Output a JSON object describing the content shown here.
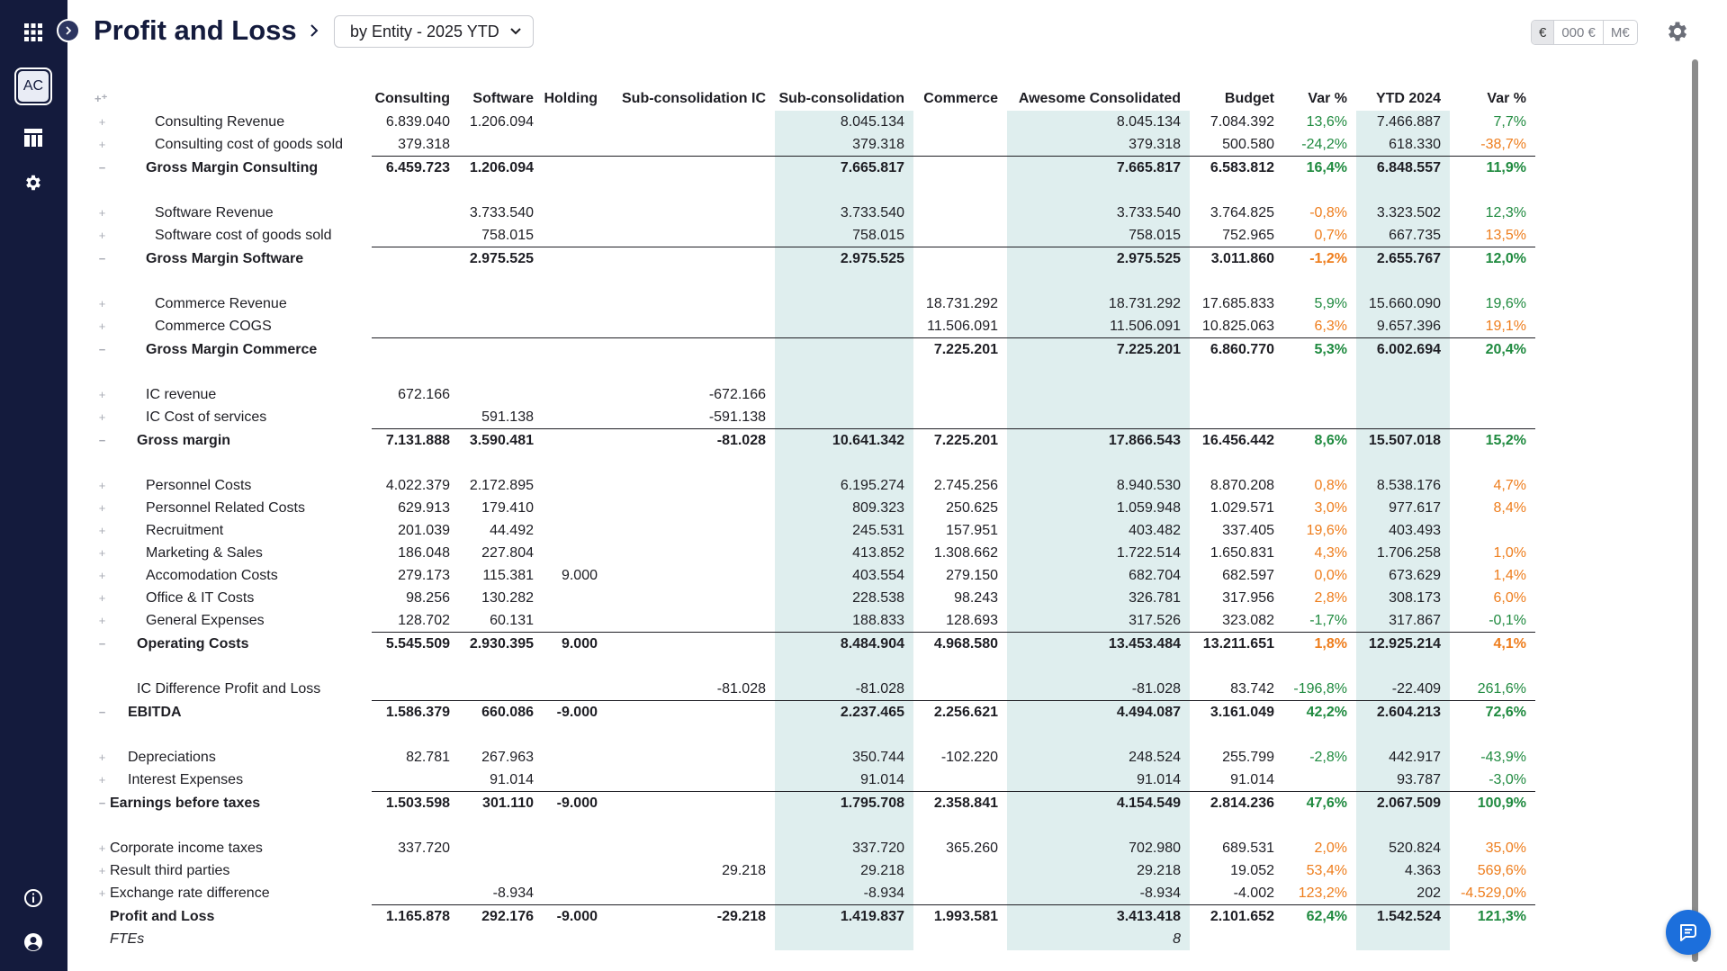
{
  "header": {
    "title": "Profit and Loss",
    "view_selector": "by Entity - 2025 YTD",
    "units": [
      "€",
      "000 €",
      "M€"
    ]
  },
  "sidebar": {
    "avatar": "AC",
    "icons": [
      "apps-grid-icon",
      "dashboard-icon",
      "settings-icon",
      "info-icon",
      "account-icon"
    ]
  },
  "colors": {
    "sidebar_bg": "#141b3d",
    "positive": "#1f8a3f",
    "negative": "#ee7d1c",
    "highlight_column": "#dfeeee",
    "chat_button": "#1c6fdc"
  },
  "table": {
    "columns": [
      "Consulting",
      "Software",
      "Holding",
      "Sub-consolidation IC",
      "Sub-consolidation",
      "Commerce",
      "Awesome Consolidated",
      "Budget",
      "Var %",
      "YTD 2024",
      "Var %"
    ],
    "rows": [
      {
        "label": "Consulting Revenue",
        "ctl": "+",
        "indent": 1,
        "type": "line",
        "vals": [
          "6.839.040",
          "1.206.094",
          "",
          "",
          "8.045.134",
          "",
          "8.045.134",
          "7.084.392",
          "13,6%",
          "7.466.887",
          "7,7%"
        ]
      },
      {
        "label": "Consulting cost of goods sold",
        "ctl": "+",
        "indent": 1,
        "type": "line",
        "vals": [
          "379.318",
          "",
          "",
          "",
          "379.318",
          "",
          "379.318",
          "500.580",
          "-24,2%",
          "618.330",
          "-38,7%"
        ]
      },
      {
        "label": "Gross Margin Consulting",
        "ctl": "−",
        "indent": 2,
        "type": "total",
        "vals": [
          "6.459.723",
          "1.206.094",
          "",
          "",
          "7.665.817",
          "",
          "7.665.817",
          "6.583.812",
          "16,4%",
          "6.848.557",
          "11,9%"
        ]
      },
      {
        "type": "gap"
      },
      {
        "label": "Software Revenue",
        "ctl": "+",
        "indent": 1,
        "type": "line",
        "vals": [
          "",
          "3.733.540",
          "",
          "",
          "3.733.540",
          "",
          "3.733.540",
          "3.764.825",
          "-0,8%",
          "3.323.502",
          "12,3%"
        ]
      },
      {
        "label": "Software cost of goods sold",
        "ctl": "+",
        "indent": 1,
        "type": "line",
        "vals": [
          "",
          "758.015",
          "",
          "",
          "758.015",
          "",
          "758.015",
          "752.965",
          "0,7%",
          "667.735",
          "13,5%"
        ]
      },
      {
        "label": "Gross Margin Software",
        "ctl": "−",
        "indent": 2,
        "type": "total",
        "vals": [
          "",
          "2.975.525",
          "",
          "",
          "2.975.525",
          "",
          "2.975.525",
          "3.011.860",
          "-1,2%",
          "2.655.767",
          "12,0%"
        ]
      },
      {
        "type": "gap"
      },
      {
        "label": "Commerce Revenue",
        "ctl": "+",
        "indent": 1,
        "type": "line",
        "vals": [
          "",
          "",
          "",
          "",
          "",
          "18.731.292",
          "18.731.292",
          "17.685.833",
          "5,9%",
          "15.660.090",
          "19,6%"
        ]
      },
      {
        "label": "Commerce COGS",
        "ctl": "+",
        "indent": 1,
        "type": "line",
        "vals": [
          "",
          "",
          "",
          "",
          "",
          "11.506.091",
          "11.506.091",
          "10.825.063",
          "6,3%",
          "9.657.396",
          "19,1%"
        ]
      },
      {
        "label": "Gross Margin Commerce",
        "ctl": "−",
        "indent": 2,
        "type": "total",
        "vals": [
          "",
          "",
          "",
          "",
          "",
          "7.225.201",
          "7.225.201",
          "6.860.770",
          "5,3%",
          "6.002.694",
          "20,4%"
        ]
      },
      {
        "type": "gap"
      },
      {
        "label": "IC revenue",
        "ctl": "+",
        "indent": 2,
        "type": "line",
        "vals": [
          "672.166",
          "",
          "",
          "-672.166",
          "",
          "",
          "",
          "",
          "",
          "",
          ""
        ]
      },
      {
        "label": "IC Cost of services",
        "ctl": "+",
        "indent": 2,
        "type": "line",
        "vals": [
          "",
          "591.138",
          "",
          "-591.138",
          "",
          "",
          "",
          "",
          "",
          "",
          ""
        ]
      },
      {
        "label": "Gross margin",
        "ctl": "−",
        "indent": 3,
        "type": "total",
        "vals": [
          "7.131.888",
          "3.590.481",
          "",
          "-81.028",
          "10.641.342",
          "7.225.201",
          "17.866.543",
          "16.456.442",
          "8,6%",
          "15.507.018",
          "15,2%"
        ]
      },
      {
        "type": "gap"
      },
      {
        "label": "Personnel Costs",
        "ctl": "+",
        "indent": 2,
        "type": "line",
        "vals": [
          "4.022.379",
          "2.172.895",
          "",
          "",
          "6.195.274",
          "2.745.256",
          "8.940.530",
          "8.870.208",
          "0,8%",
          "8.538.176",
          "4,7%"
        ]
      },
      {
        "label": "Personnel Related Costs",
        "ctl": "+",
        "indent": 2,
        "type": "line",
        "vals": [
          "629.913",
          "179.410",
          "",
          "",
          "809.323",
          "250.625",
          "1.059.948",
          "1.029.571",
          "3,0%",
          "977.617",
          "8,4%"
        ]
      },
      {
        "label": "Recruitment",
        "ctl": "+",
        "indent": 2,
        "type": "line",
        "vals": [
          "201.039",
          "44.492",
          "",
          "",
          "245.531",
          "157.951",
          "403.482",
          "337.405",
          "19,6%",
          "403.493",
          ""
        ]
      },
      {
        "label": "Marketing & Sales",
        "ctl": "+",
        "indent": 2,
        "type": "line",
        "vals": [
          "186.048",
          "227.804",
          "",
          "",
          "413.852",
          "1.308.662",
          "1.722.514",
          "1.650.831",
          "4,3%",
          "1.706.258",
          "1,0%"
        ]
      },
      {
        "label": "Accomodation Costs",
        "ctl": "+",
        "indent": 2,
        "type": "line",
        "vals": [
          "279.173",
          "115.381",
          "9.000",
          "",
          "403.554",
          "279.150",
          "682.704",
          "682.597",
          "0,0%",
          "673.629",
          "1,4%"
        ]
      },
      {
        "label": "Office & IT Costs",
        "ctl": "+",
        "indent": 2,
        "type": "line",
        "vals": [
          "98.256",
          "130.282",
          "",
          "",
          "228.538",
          "98.243",
          "326.781",
          "317.956",
          "2,8%",
          "308.173",
          "6,0%"
        ]
      },
      {
        "label": "General Expenses",
        "ctl": "+",
        "indent": 2,
        "type": "line",
        "vals": [
          "128.702",
          "60.131",
          "",
          "",
          "188.833",
          "128.693",
          "317.526",
          "323.082",
          "-1,7%",
          "317.867",
          "-0,1%"
        ]
      },
      {
        "label": "Operating Costs",
        "ctl": "−",
        "indent": 3,
        "type": "total",
        "vals": [
          "5.545.509",
          "2.930.395",
          "9.000",
          "",
          "8.484.904",
          "4.968.580",
          "13.453.484",
          "13.211.651",
          "1,8%",
          "12.925.214",
          "4,1%"
        ]
      },
      {
        "type": "gap"
      },
      {
        "label": "IC Difference Profit and Loss",
        "ctl": "",
        "indent": 3,
        "type": "line",
        "vals": [
          "",
          "",
          "",
          "-81.028",
          "-81.028",
          "",
          "-81.028",
          "83.742",
          "-196,8%",
          "-22.409",
          "261,6%"
        ]
      },
      {
        "label": "EBITDA",
        "ctl": "−",
        "indent": 4,
        "type": "total",
        "vals": [
          "1.586.379",
          "660.086",
          "-9.000",
          "",
          "2.237.465",
          "2.256.621",
          "4.494.087",
          "3.161.049",
          "42,2%",
          "2.604.213",
          "72,6%"
        ]
      },
      {
        "type": "gap"
      },
      {
        "label": "Depreciations",
        "ctl": "+",
        "indent": 4,
        "type": "line",
        "vals": [
          "82.781",
          "267.963",
          "",
          "",
          "350.744",
          "-102.220",
          "248.524",
          "255.799",
          "-2,8%",
          "442.917",
          "-43,9%"
        ]
      },
      {
        "label": "Interest Expenses",
        "ctl": "+",
        "indent": 4,
        "type": "line",
        "vals": [
          "",
          "91.014",
          "",
          "",
          "91.014",
          "",
          "91.014",
          "91.014",
          "",
          "93.787",
          "-3,0%"
        ]
      },
      {
        "label": "Earnings before taxes",
        "ctl": "−",
        "indent": 5,
        "type": "total",
        "vals": [
          "1.503.598",
          "301.110",
          "-9.000",
          "",
          "1.795.708",
          "2.358.841",
          "4.154.549",
          "2.814.236",
          "47,6%",
          "2.067.509",
          "100,9%"
        ]
      },
      {
        "type": "gap"
      },
      {
        "label": "Corporate income taxes",
        "ctl": "+",
        "indent": 5,
        "type": "line",
        "vals": [
          "337.720",
          "",
          "",
          "",
          "337.720",
          "365.260",
          "702.980",
          "689.531",
          "2,0%",
          "520.824",
          "35,0%"
        ]
      },
      {
        "label": "Result third parties",
        "ctl": "+",
        "indent": 5,
        "type": "line",
        "vals": [
          "",
          "",
          "",
          "29.218",
          "29.218",
          "",
          "29.218",
          "19.052",
          "53,4%",
          "4.363",
          "569,6%"
        ]
      },
      {
        "label": "Exchange rate difference",
        "ctl": "+",
        "indent": 5,
        "type": "line",
        "vals": [
          "",
          "-8.934",
          "",
          "",
          "-8.934",
          "",
          "-8.934",
          "-4.002",
          "123,2%",
          "202",
          "-4.529,0%"
        ]
      },
      {
        "label": "Profit and Loss",
        "ctl": "",
        "indent": 6,
        "type": "total",
        "vals": [
          "1.165.878",
          "292.176",
          "-9.000",
          "-29.218",
          "1.419.837",
          "1.993.581",
          "3.413.418",
          "2.101.652",
          "62,4%",
          "1.542.524",
          "121,3%"
        ]
      },
      {
        "label": "FTEs",
        "ctl": "",
        "indent": 6,
        "type": "fte",
        "vals": [
          "",
          "",
          "",
          "",
          "",
          "",
          "8",
          "",
          "",
          "",
          ""
        ]
      }
    ],
    "var_colors": [
      [
        "pos",
        "pos"
      ],
      [
        "pos",
        "neg"
      ],
      [
        "pos",
        "pos"
      ],
      [],
      [
        "neg",
        "pos"
      ],
      [
        "neg",
        "neg"
      ],
      [
        "neg",
        "pos"
      ],
      [],
      [
        "pos",
        "pos"
      ],
      [
        "neg",
        "neg"
      ],
      [
        "pos",
        "pos"
      ],
      [],
      [
        "",
        ""
      ],
      [
        "",
        ""
      ],
      [
        "pos",
        "pos"
      ],
      [],
      [
        "neg",
        "neg"
      ],
      [
        "neg",
        "neg"
      ],
      [
        "neg",
        ""
      ],
      [
        "neg",
        "neg"
      ],
      [
        "neg",
        "neg"
      ],
      [
        "neg",
        "neg"
      ],
      [
        "pos",
        "pos"
      ],
      [
        "neg",
        "neg"
      ],
      [],
      [
        "pos",
        "pos"
      ],
      [
        "pos",
        "pos"
      ],
      [],
      [
        "pos",
        "pos"
      ],
      [
        "",
        "pos"
      ],
      [
        "pos",
        "pos"
      ],
      [],
      [
        "neg",
        "neg"
      ],
      [
        "neg",
        "neg"
      ],
      [
        "neg",
        "neg"
      ],
      [
        "pos",
        "pos"
      ],
      [
        "",
        ""
      ]
    ]
  }
}
